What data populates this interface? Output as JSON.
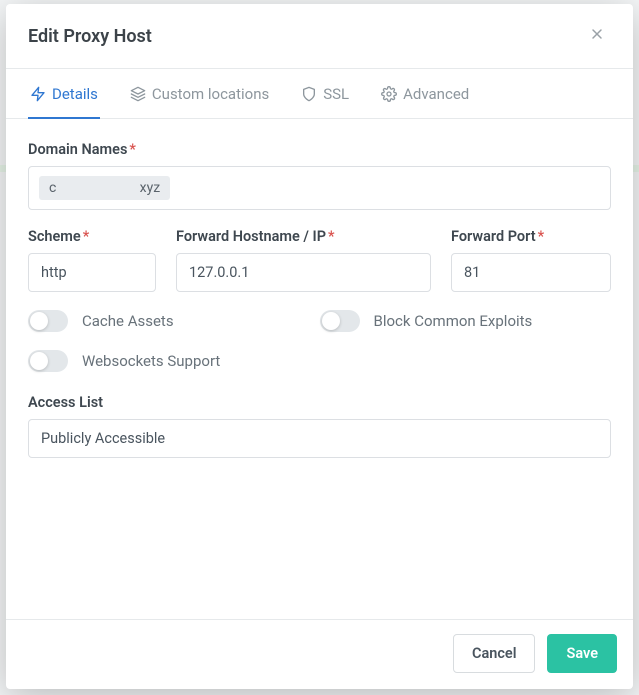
{
  "header": {
    "title": "Edit Proxy Host"
  },
  "tabs": {
    "details": "Details",
    "custom_locations": "Custom locations",
    "ssl": "SSL",
    "advanced": "Advanced"
  },
  "labels": {
    "domain_names": "Domain Names",
    "scheme": "Scheme",
    "forward_hostname": "Forward Hostname / IP",
    "forward_port": "Forward Port",
    "access_list": "Access List"
  },
  "form": {
    "domain_chip": "c                        xyz",
    "scheme": "http",
    "forward_hostname": "127.0.0.1",
    "forward_port": "81",
    "access_list": "Publicly Accessible"
  },
  "toggles": {
    "cache_assets": "Cache Assets",
    "block_exploits": "Block Common Exploits",
    "websockets": "Websockets Support"
  },
  "footer": {
    "cancel": "Cancel",
    "save": "Save"
  }
}
